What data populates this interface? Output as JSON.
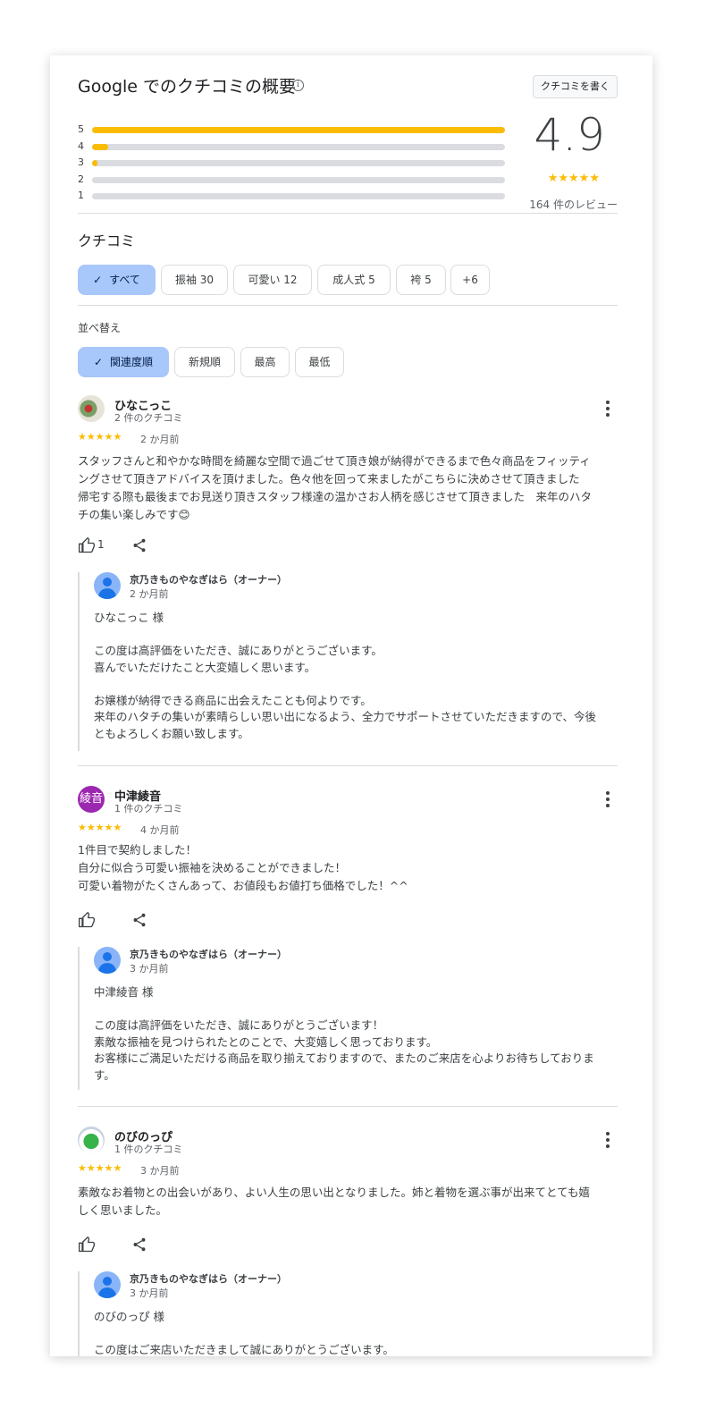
{
  "header": {
    "title": "Google でのクチコミの概要",
    "write_button": "クチコミを書く"
  },
  "summary": {
    "score": "4.9",
    "stars": "★★★★★",
    "review_count": "164 件のレビュー",
    "distribution": [
      {
        "label": "5",
        "fraction": 1.0
      },
      {
        "label": "4",
        "fraction": 0.04
      },
      {
        "label": "3",
        "fraction": 0.012
      },
      {
        "label": "2",
        "fraction": 0.0
      },
      {
        "label": "1",
        "fraction": 0.0
      }
    ]
  },
  "reviews_section": {
    "label": "クチコミ"
  },
  "filter_chips": [
    "すべて",
    "振袖 30",
    "可愛い 12",
    "成人式 5",
    "袴 5",
    "+6"
  ],
  "sort": {
    "label": "並べ替え",
    "options": [
      "関連度順",
      "新規順",
      "最高",
      "最低"
    ]
  },
  "reviews": [
    {
      "name": "ひなこっこ",
      "meta": "2 件のクチコミ",
      "stars": "★★★★★",
      "date": "2 か月前",
      "text": "スタッフさんと和やかな時間を綺麗な空間で過ごせて頂き娘が納得ができるまで色々商品をフィッティ\nングさせて頂きアドバイスを頂けました。色々他を回って来ましたがこちらに決めさせて頂きました\n帰宅する際も最後までお見送り頂きスタッフ様達の温かさお人柄を感じさせて頂きました　来年のハタ\nチの集い楽しみです😊",
      "likes": "1",
      "reply": {
        "owner": "京乃きものやなぎはら（オーナー）",
        "date": "2 か月前",
        "text": "ひなこっこ 様\n\nこの度は高評価をいただき、誠にありがとうございます。\n喜んでいただけたこと大変嬉しく思います。\n\nお嬢様が納得できる商品に出会えたことも何よりです。\n来年のハタチの集いが素晴らしい思い出になるよう、全力でサポートさせていただきますので、今後\nともよろしくお願い致します。"
      }
    },
    {
      "name": "中津綾音",
      "avatar_text": "綾音",
      "meta": "1 件のクチコミ",
      "stars": "★★★★★",
      "date": "4 か月前",
      "text": "1件目で契約しました！\n自分に似合う可愛い振袖を決めることができました！\n可愛い着物がたくさんあって、お値段もお値打ち価格でした！^^",
      "likes": "",
      "reply": {
        "owner": "京乃きものやなぎはら（オーナー）",
        "date": "3 か月前",
        "text": "中津綾音 様\n\nこの度は高評価をいただき、誠にありがとうございます！\n素敵な振袖を見つけられたとのことで、大変嬉しく思っております。\nお客様にご満足いただける商品を取り揃えておりますので、またのご来店を心よりお待ちしておりま\nす。"
      }
    },
    {
      "name": "のびのっぴ",
      "meta": "1 件のクチコミ",
      "stars": "★★★★★",
      "date": "3 か月前",
      "text": "素敵なお着物との出会いがあり、よい人生の思い出となりました。姉と着物を選ぶ事が出来てとても嬉\nしく思いました。",
      "likes": "",
      "reply": {
        "owner": "京乃きものやなぎはら（オーナー）",
        "date": "3 か月前",
        "text": "のびのっぴ 様\n\nこの度はご来店いただきまして誠にありがとうございます。"
      }
    }
  ],
  "colors": {
    "star": "#fbbc04",
    "chip_active": "#a8c7fa",
    "bar_bg": "#dadce0",
    "owner_avatar": "#1a73e8"
  },
  "icons": [
    "info-icon",
    "check-icon",
    "more-vert-icon",
    "thumb-up-icon",
    "share-icon",
    "account-icon"
  ]
}
